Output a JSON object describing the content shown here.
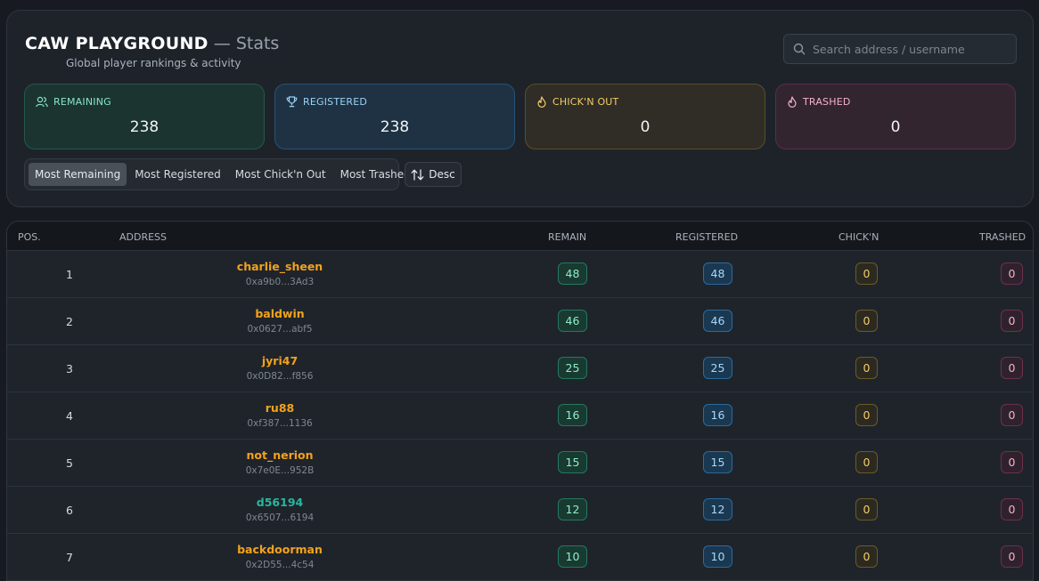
{
  "header": {
    "brand": "CAW PLAYGROUND",
    "separator": "—",
    "section": "Stats",
    "subtitle": "Global player rankings & activity"
  },
  "search": {
    "placeholder": "Search address / username",
    "value": ""
  },
  "stats": [
    {
      "label": "REMAINING",
      "value": "238",
      "icon": "users-icon"
    },
    {
      "label": "REGISTERED",
      "value": "238",
      "icon": "trophy-icon"
    },
    {
      "label": "CHICK'N OUT",
      "value": "0",
      "icon": "flame-icon"
    },
    {
      "label": "TRASHED",
      "value": "0",
      "icon": "flame-icon"
    }
  ],
  "sort": {
    "options": [
      "Most Remaining",
      "Most Registered",
      "Most Chick'n Out",
      "Most Trashed"
    ],
    "selected": "Most Remaining",
    "order_label": "Desc",
    "order_icon": "sort-arrows-icon"
  },
  "table": {
    "columns": [
      "POS.",
      "ADDRESS",
      "REMAIN",
      "REGISTERED",
      "CHICK'N",
      "TRASHED"
    ],
    "rows": [
      {
        "pos": "1",
        "name": "charlie_sheen",
        "address": "0xa9b0...3Ad3",
        "remain": "48",
        "registered": "48",
        "chickn": "0",
        "trashed": "0",
        "name_color": "#f3a21b"
      },
      {
        "pos": "2",
        "name": "baldwin",
        "address": "0x0627...abf5",
        "remain": "46",
        "registered": "46",
        "chickn": "0",
        "trashed": "0",
        "name_color": "#f3a21b"
      },
      {
        "pos": "3",
        "name": "jyri47",
        "address": "0x0D82...f856",
        "remain": "25",
        "registered": "25",
        "chickn": "0",
        "trashed": "0",
        "name_color": "#f3a21b"
      },
      {
        "pos": "4",
        "name": "ru88",
        "address": "0xf387...1136",
        "remain": "16",
        "registered": "16",
        "chickn": "0",
        "trashed": "0",
        "name_color": "#f3a21b"
      },
      {
        "pos": "5",
        "name": "not_nerion",
        "address": "0x7e0E...952B",
        "remain": "15",
        "registered": "15",
        "chickn": "0",
        "trashed": "0",
        "name_color": "#f3a21b"
      },
      {
        "pos": "6",
        "name": "d56194",
        "address": "0x6507...6194",
        "remain": "12",
        "registered": "12",
        "chickn": "0",
        "trashed": "0",
        "name_color": "#2ab5a0"
      },
      {
        "pos": "7",
        "name": "backdoorman",
        "address": "0x2D55...4c54",
        "remain": "10",
        "registered": "10",
        "chickn": "0",
        "trashed": "0",
        "name_color": "#f3a21b"
      }
    ]
  },
  "colors": {
    "remain": "#8fecc9",
    "registered": "#a6d8fb",
    "chickn": "#f3cc6c",
    "trashed": "#f2b2cc"
  }
}
